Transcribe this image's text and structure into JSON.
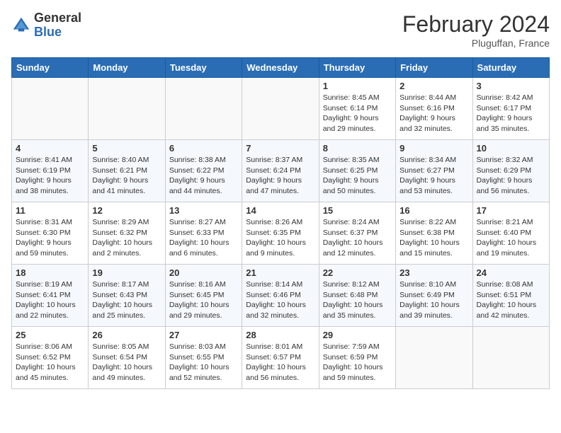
{
  "header": {
    "logo_general": "General",
    "logo_blue": "Blue",
    "month_title": "February 2024",
    "subtitle": "Pluguffan, France"
  },
  "days_of_week": [
    "Sunday",
    "Monday",
    "Tuesday",
    "Wednesday",
    "Thursday",
    "Friday",
    "Saturday"
  ],
  "weeks": [
    [
      {
        "day": "",
        "info": ""
      },
      {
        "day": "",
        "info": ""
      },
      {
        "day": "",
        "info": ""
      },
      {
        "day": "",
        "info": ""
      },
      {
        "day": "1",
        "info": "Sunrise: 8:45 AM\nSunset: 6:14 PM\nDaylight: 9 hours and 29 minutes."
      },
      {
        "day": "2",
        "info": "Sunrise: 8:44 AM\nSunset: 6:16 PM\nDaylight: 9 hours and 32 minutes."
      },
      {
        "day": "3",
        "info": "Sunrise: 8:42 AM\nSunset: 6:17 PM\nDaylight: 9 hours and 35 minutes."
      }
    ],
    [
      {
        "day": "4",
        "info": "Sunrise: 8:41 AM\nSunset: 6:19 PM\nDaylight: 9 hours and 38 minutes."
      },
      {
        "day": "5",
        "info": "Sunrise: 8:40 AM\nSunset: 6:21 PM\nDaylight: 9 hours and 41 minutes."
      },
      {
        "day": "6",
        "info": "Sunrise: 8:38 AM\nSunset: 6:22 PM\nDaylight: 9 hours and 44 minutes."
      },
      {
        "day": "7",
        "info": "Sunrise: 8:37 AM\nSunset: 6:24 PM\nDaylight: 9 hours and 47 minutes."
      },
      {
        "day": "8",
        "info": "Sunrise: 8:35 AM\nSunset: 6:25 PM\nDaylight: 9 hours and 50 minutes."
      },
      {
        "day": "9",
        "info": "Sunrise: 8:34 AM\nSunset: 6:27 PM\nDaylight: 9 hours and 53 minutes."
      },
      {
        "day": "10",
        "info": "Sunrise: 8:32 AM\nSunset: 6:29 PM\nDaylight: 9 hours and 56 minutes."
      }
    ],
    [
      {
        "day": "11",
        "info": "Sunrise: 8:31 AM\nSunset: 6:30 PM\nDaylight: 9 hours and 59 minutes."
      },
      {
        "day": "12",
        "info": "Sunrise: 8:29 AM\nSunset: 6:32 PM\nDaylight: 10 hours and 2 minutes."
      },
      {
        "day": "13",
        "info": "Sunrise: 8:27 AM\nSunset: 6:33 PM\nDaylight: 10 hours and 6 minutes."
      },
      {
        "day": "14",
        "info": "Sunrise: 8:26 AM\nSunset: 6:35 PM\nDaylight: 10 hours and 9 minutes."
      },
      {
        "day": "15",
        "info": "Sunrise: 8:24 AM\nSunset: 6:37 PM\nDaylight: 10 hours and 12 minutes."
      },
      {
        "day": "16",
        "info": "Sunrise: 8:22 AM\nSunset: 6:38 PM\nDaylight: 10 hours and 15 minutes."
      },
      {
        "day": "17",
        "info": "Sunrise: 8:21 AM\nSunset: 6:40 PM\nDaylight: 10 hours and 19 minutes."
      }
    ],
    [
      {
        "day": "18",
        "info": "Sunrise: 8:19 AM\nSunset: 6:41 PM\nDaylight: 10 hours and 22 minutes."
      },
      {
        "day": "19",
        "info": "Sunrise: 8:17 AM\nSunset: 6:43 PM\nDaylight: 10 hours and 25 minutes."
      },
      {
        "day": "20",
        "info": "Sunrise: 8:16 AM\nSunset: 6:45 PM\nDaylight: 10 hours and 29 minutes."
      },
      {
        "day": "21",
        "info": "Sunrise: 8:14 AM\nSunset: 6:46 PM\nDaylight: 10 hours and 32 minutes."
      },
      {
        "day": "22",
        "info": "Sunrise: 8:12 AM\nSunset: 6:48 PM\nDaylight: 10 hours and 35 minutes."
      },
      {
        "day": "23",
        "info": "Sunrise: 8:10 AM\nSunset: 6:49 PM\nDaylight: 10 hours and 39 minutes."
      },
      {
        "day": "24",
        "info": "Sunrise: 8:08 AM\nSunset: 6:51 PM\nDaylight: 10 hours and 42 minutes."
      }
    ],
    [
      {
        "day": "25",
        "info": "Sunrise: 8:06 AM\nSunset: 6:52 PM\nDaylight: 10 hours and 45 minutes."
      },
      {
        "day": "26",
        "info": "Sunrise: 8:05 AM\nSunset: 6:54 PM\nDaylight: 10 hours and 49 minutes."
      },
      {
        "day": "27",
        "info": "Sunrise: 8:03 AM\nSunset: 6:55 PM\nDaylight: 10 hours and 52 minutes."
      },
      {
        "day": "28",
        "info": "Sunrise: 8:01 AM\nSunset: 6:57 PM\nDaylight: 10 hours and 56 minutes."
      },
      {
        "day": "29",
        "info": "Sunrise: 7:59 AM\nSunset: 6:59 PM\nDaylight: 10 hours and 59 minutes."
      },
      {
        "day": "",
        "info": ""
      },
      {
        "day": "",
        "info": ""
      }
    ]
  ]
}
